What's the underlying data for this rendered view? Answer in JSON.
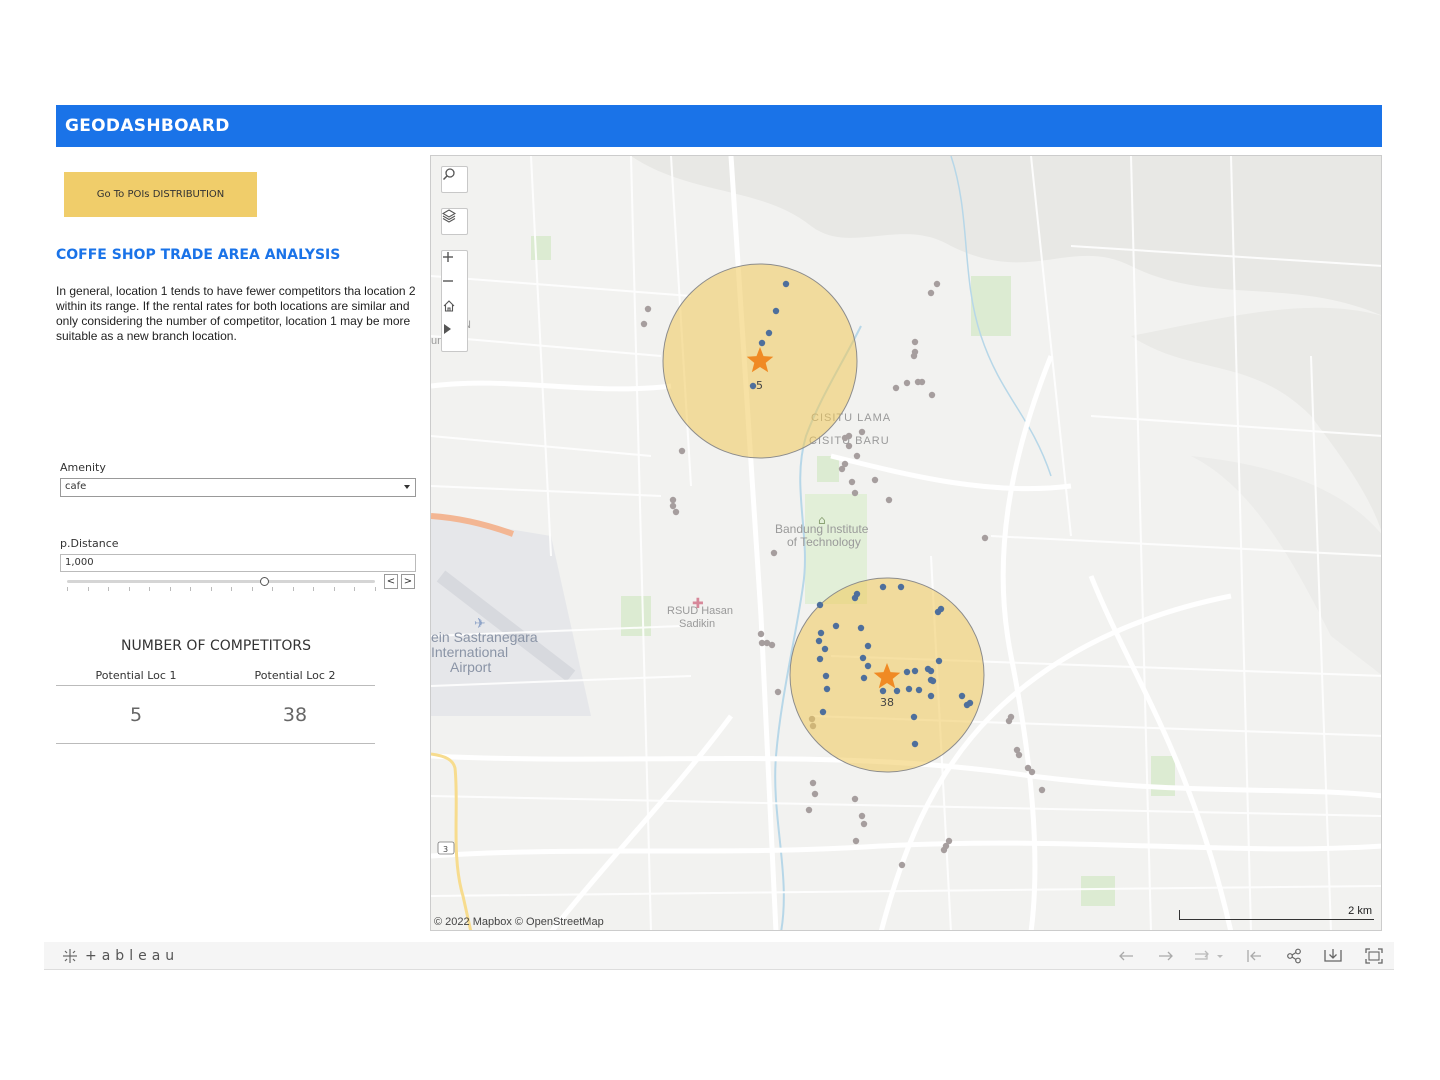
{
  "header": {
    "title": "GEODASHBOARD"
  },
  "nav_button": {
    "label": "Go To POIs DISTRIBUTION"
  },
  "analysis": {
    "title": "COFFE SHOP TRADE AREA ANALYSIS",
    "description": "In general, location 1 tends to have fewer competitors tha location 2 within its range. If the rental rates for both locations are similar and only considering the number of competitor, location 1 may be more suitable as a new branch location."
  },
  "filters": {
    "amenity": {
      "label": "Amenity",
      "value": "cafe"
    },
    "distance": {
      "label": "p.Distance",
      "value": "1,000",
      "slider_fraction": 0.64,
      "prev": "<",
      "next": ">"
    }
  },
  "kpi": {
    "title": "NUMBER OF COMPETITORS",
    "loc1": {
      "label": "Potential Loc 1",
      "value": "5"
    },
    "loc2": {
      "label": "Potential Loc 2",
      "value": "38"
    }
  },
  "map": {
    "labels": {
      "cisitu_lama": "CISITU LAMA",
      "cisitu_baru": "CISITU BARU",
      "itb_line1": "Bandung Institute",
      "itb_line2": "of Technology",
      "rsud_line1": "RSUD Hasan",
      "rsud_line2": "Sadikin",
      "airport_line1": "ein Sastranegara",
      "airport_line2": "International",
      "airport_line3": "Airport",
      "road_shield": "3",
      "edge_label1": "N",
      "edge_label2": "un"
    },
    "loc1_count_label": "5",
    "loc2_count_label": "38",
    "attribution": "© 2022 Mapbox  © OpenStreetMap",
    "scale_label": "2 km",
    "colors": {
      "trade_area": "#f0c85a",
      "star": "#f08a24",
      "competitor": "#4e6f9c",
      "other_poi": "#a69e9e"
    },
    "tools": [
      "search-icon",
      "layers-icon",
      "zoom-in",
      "zoom-out",
      "home-icon",
      "pan-arrow-icon"
    ]
  },
  "toolbar": {
    "brand": "+ableau",
    "icons": [
      "undo-icon",
      "redo-icon",
      "replay-icon",
      "revert-icon",
      "share-icon",
      "download-icon",
      "fullscreen-icon"
    ]
  }
}
